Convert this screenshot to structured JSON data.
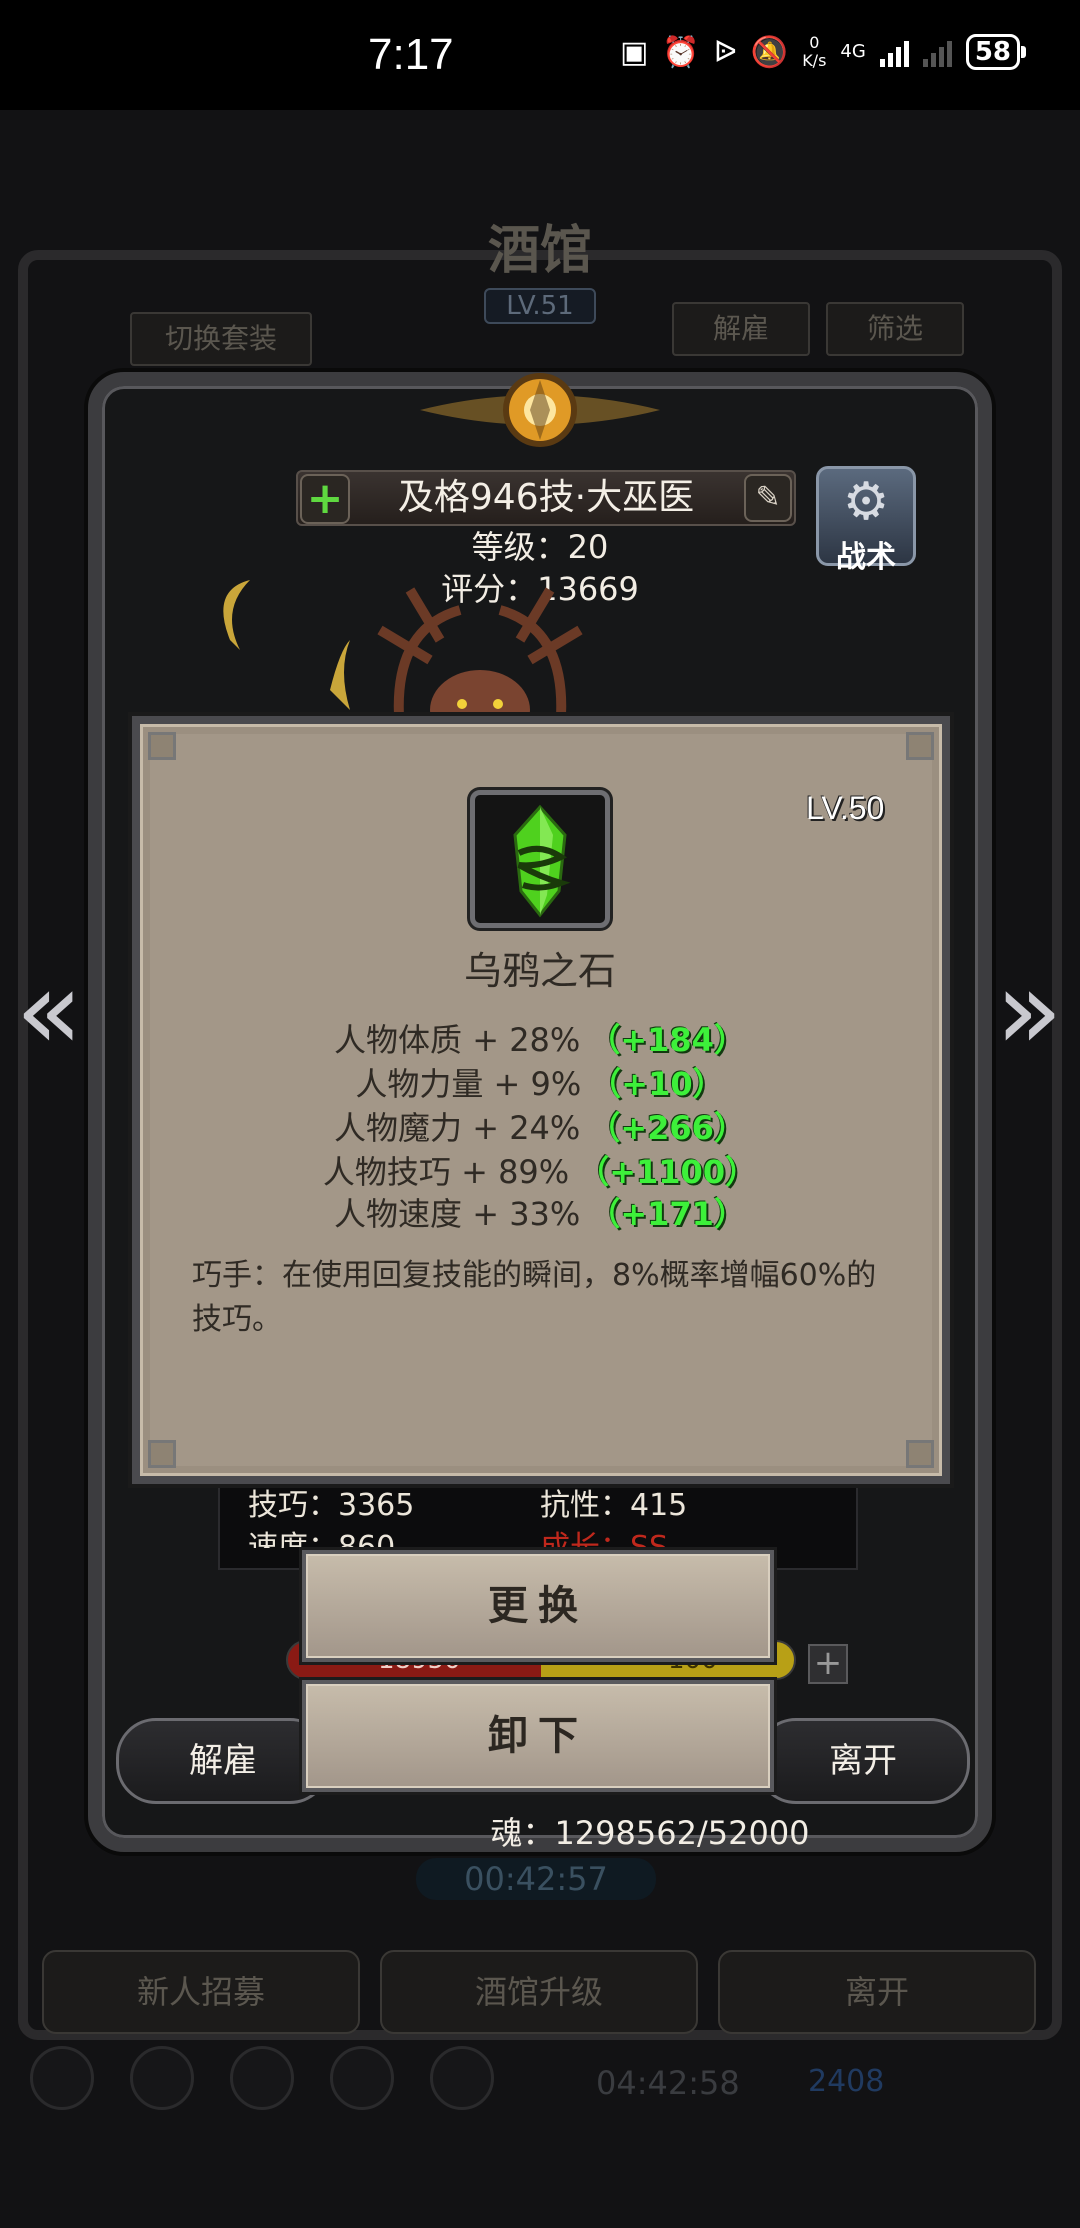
{
  "status_bar": {
    "time": "7:17",
    "speed_value": "0",
    "speed_unit": "K/s",
    "network": "4G",
    "battery": "58"
  },
  "background": {
    "title": "酒馆",
    "level": "LV.51",
    "switch_outfit": "切换套装",
    "dismiss": "解雇",
    "filter": "筛选",
    "timer": "00:42:57",
    "recruit": "新人招募",
    "upgrade": "酒馆升级",
    "leave": "离开",
    "timer2": "04:42:58",
    "gems": "2408"
  },
  "hero": {
    "name": "及格946技·大巫医",
    "level_label": "等级：20",
    "score_label": "评分：13669",
    "tactic_label": "战术",
    "stats": {
      "skill": "技巧：3365",
      "resist": "抗性：415",
      "speed": "速度：860",
      "growth": "成长：SS"
    },
    "hp_value": "18950",
    "mp_value": "100",
    "dismiss_button": "解雇",
    "leave_button": "离开",
    "soul": "魂：1298562/52000"
  },
  "item": {
    "level": "LV.50",
    "name": "乌鸦之石",
    "attributes": [
      {
        "label": "人物体质 + 28%",
        "bonus": "（+184）"
      },
      {
        "label": "人物力量 + 9%",
        "bonus": "（+10）"
      },
      {
        "label": "人物魔力 + 24%",
        "bonus": "（+266）"
      },
      {
        "label": "人物技巧 + 89%",
        "bonus": "（+1100）"
      },
      {
        "label": "人物速度 + 33%",
        "bonus": "（+171）"
      }
    ],
    "description": "巧手：在使用回复技能的瞬间，8%概率增幅60%的技巧。"
  },
  "actions": {
    "replace": "更换",
    "unequip": "卸下"
  },
  "icons": {
    "nfc": "nfc-icon",
    "alarm": "alarm-icon",
    "bluetooth": "bluetooth-icon",
    "mute": "mute-icon",
    "gear": "gear-icon",
    "crystal": "crow-stone-icon"
  },
  "colors": {
    "bonus_green": "#3df03a",
    "card_bg": "#a39788",
    "growth_red": "#c0281c"
  }
}
